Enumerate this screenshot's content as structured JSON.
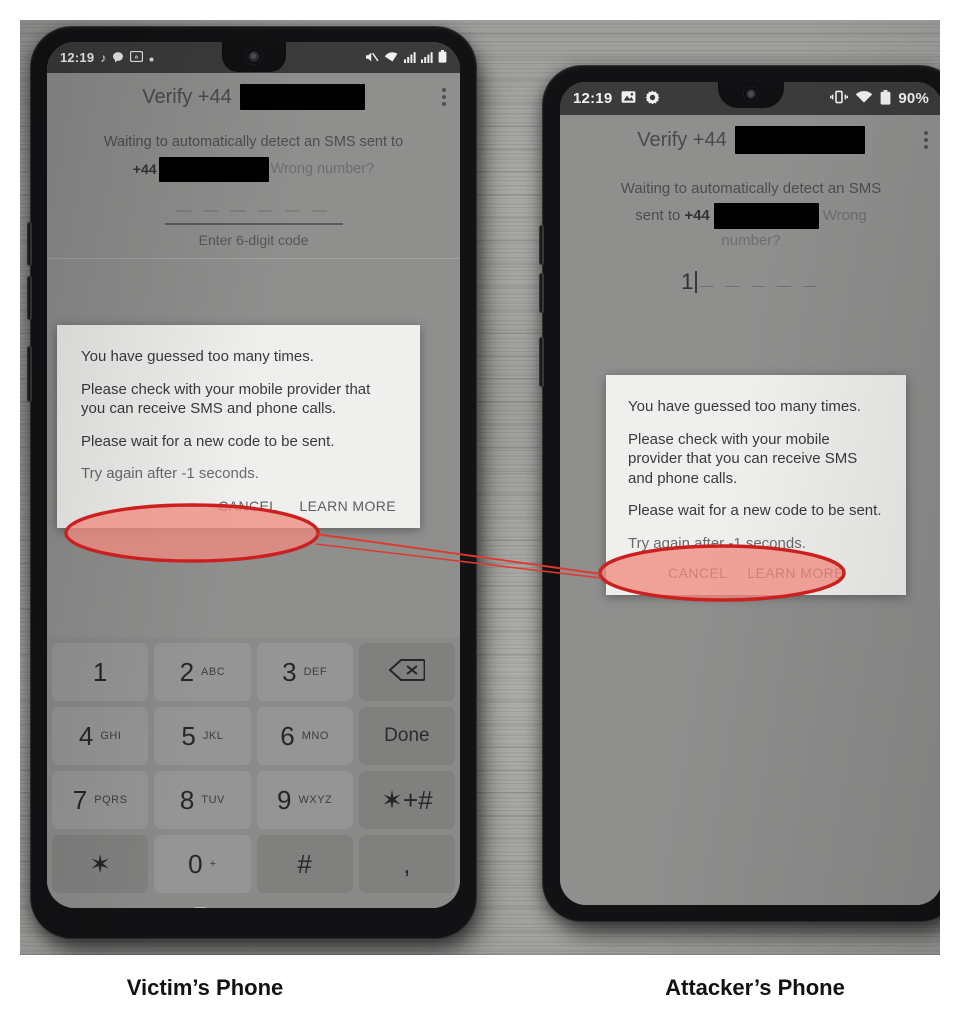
{
  "figure": {
    "captions": {
      "left": "Victim’s Phone",
      "right": "Attacker’s Phone"
    },
    "annotation": {
      "highlight_color": "#cc1f1f",
      "highlight_fill": "#f08a80",
      "connector_color": "#e03a2f",
      "highlighted_text": "Try again after -1 seconds."
    },
    "background": "wooden-desk"
  },
  "victim_phone": {
    "label": "Victim’s Phone",
    "status_bar": {
      "time": "12:19",
      "left_icons": [
        "tiktok-icon",
        "chat-bubble-icon",
        "screenshot-icon",
        "dot-icon"
      ],
      "right_icons": [
        "mute-icon",
        "wifi-icon",
        "signal-bars-icon",
        "signal-bars-icon",
        "battery-icon"
      ]
    },
    "app_bar": {
      "title_prefix": "Verify +44",
      "redacted_number": "",
      "overflow_menu": "more-options-icon"
    },
    "content": {
      "waiting_line1": "Waiting to automatically detect an SMS sent to",
      "country_code": "+44",
      "redacted_number": "",
      "wrong_number_link": "Wrong number?",
      "code_dashes": "— — —   — — —",
      "code_hint": "Enter 6-digit code"
    },
    "dialog": {
      "line1": "You have guessed too many times.",
      "line2": "Please check with your mobile provider that you can receive SMS and phone calls.",
      "line3": "Please wait for a new code to be sent.",
      "line4": "Try again after -1 seconds.",
      "cancel_label": "CANCEL",
      "learn_more_label": "LEARN MORE"
    },
    "keypad": {
      "rows": [
        [
          {
            "num": "1",
            "sub": ""
          },
          {
            "num": "2",
            "sub": "ABC"
          },
          {
            "num": "3",
            "sub": "DEF"
          },
          {
            "num": "",
            "sub": "",
            "icon": "backspace-icon"
          }
        ],
        [
          {
            "num": "4",
            "sub": "GHI"
          },
          {
            "num": "5",
            "sub": "JKL"
          },
          {
            "num": "6",
            "sub": "MNO"
          },
          {
            "num": "",
            "sub": "",
            "word": "Done"
          }
        ],
        [
          {
            "num": "7",
            "sub": "PQRS"
          },
          {
            "num": "8",
            "sub": "TUV"
          },
          {
            "num": "9",
            "sub": "WXYZ"
          },
          {
            "num": "",
            "sub": "",
            "word": "✶+#"
          }
        ],
        [
          {
            "num": "✶",
            "sub": ""
          },
          {
            "num": "0",
            "sub": "+"
          },
          {
            "num": "#",
            "sub": ""
          },
          {
            "num": ",",
            "sub": ""
          }
        ]
      ]
    },
    "nav_bar": {
      "recents": "recents-icon",
      "home": "home-icon",
      "collapse_keyboard": "chevron-down-icon",
      "keyboard_switch": "keyboard-icon"
    }
  },
  "attacker_phone": {
    "label": "Attacker’s Phone",
    "status_bar": {
      "time": "12:19",
      "left_icons": [
        "image-icon",
        "gear-icon"
      ],
      "right_icons": [
        "vibrate-icon",
        "wifi-icon",
        "battery-icon"
      ],
      "battery_percent": "90%"
    },
    "app_bar": {
      "title_prefix": "Verify +44",
      "redacted_number": "",
      "overflow_menu": "more-options-icon"
    },
    "content": {
      "waiting_line1": "Waiting to automatically detect an SMS",
      "waiting_line2_prefix": "sent to",
      "country_code": "+44",
      "redacted_number": "",
      "wrong_number_link": "Wrong",
      "wrong_number_link2": "number?",
      "entered_code": "1",
      "code_dashes": "— —   — — —"
    },
    "dialog": {
      "line1": "You have guessed too many times.",
      "line2": "Please check with your mobile provider that you can receive SMS and phone calls.",
      "line3": "Please wait for a new code to be sent.",
      "line4": "Try again after -1 seconds.",
      "cancel_label": "CANCEL",
      "learn_more_label": "LEARN MORE"
    },
    "nav_bar": {
      "home_indicator": "home-indicator"
    }
  }
}
